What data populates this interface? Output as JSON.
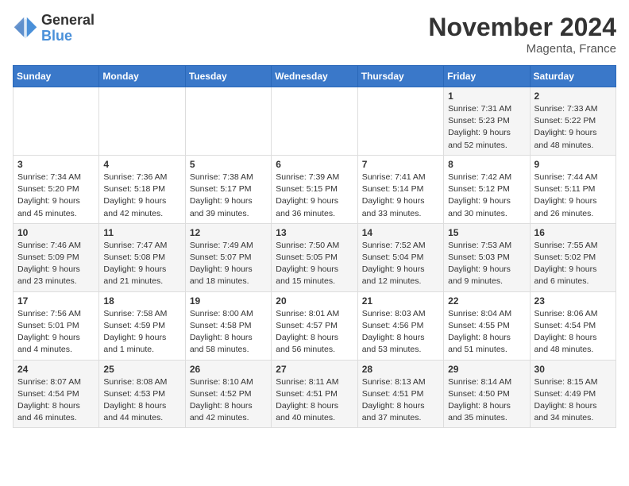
{
  "header": {
    "logo_general": "General",
    "logo_blue": "Blue",
    "month_title": "November 2024",
    "location": "Magenta, France"
  },
  "weekdays": [
    "Sunday",
    "Monday",
    "Tuesday",
    "Wednesday",
    "Thursday",
    "Friday",
    "Saturday"
  ],
  "weeks": [
    [
      {
        "day": "",
        "info": ""
      },
      {
        "day": "",
        "info": ""
      },
      {
        "day": "",
        "info": ""
      },
      {
        "day": "",
        "info": ""
      },
      {
        "day": "",
        "info": ""
      },
      {
        "day": "1",
        "info": "Sunrise: 7:31 AM\nSunset: 5:23 PM\nDaylight: 9 hours and 52 minutes."
      },
      {
        "day": "2",
        "info": "Sunrise: 7:33 AM\nSunset: 5:22 PM\nDaylight: 9 hours and 48 minutes."
      }
    ],
    [
      {
        "day": "3",
        "info": "Sunrise: 7:34 AM\nSunset: 5:20 PM\nDaylight: 9 hours and 45 minutes."
      },
      {
        "day": "4",
        "info": "Sunrise: 7:36 AM\nSunset: 5:18 PM\nDaylight: 9 hours and 42 minutes."
      },
      {
        "day": "5",
        "info": "Sunrise: 7:38 AM\nSunset: 5:17 PM\nDaylight: 9 hours and 39 minutes."
      },
      {
        "day": "6",
        "info": "Sunrise: 7:39 AM\nSunset: 5:15 PM\nDaylight: 9 hours and 36 minutes."
      },
      {
        "day": "7",
        "info": "Sunrise: 7:41 AM\nSunset: 5:14 PM\nDaylight: 9 hours and 33 minutes."
      },
      {
        "day": "8",
        "info": "Sunrise: 7:42 AM\nSunset: 5:12 PM\nDaylight: 9 hours and 30 minutes."
      },
      {
        "day": "9",
        "info": "Sunrise: 7:44 AM\nSunset: 5:11 PM\nDaylight: 9 hours and 26 minutes."
      }
    ],
    [
      {
        "day": "10",
        "info": "Sunrise: 7:46 AM\nSunset: 5:09 PM\nDaylight: 9 hours and 23 minutes."
      },
      {
        "day": "11",
        "info": "Sunrise: 7:47 AM\nSunset: 5:08 PM\nDaylight: 9 hours and 21 minutes."
      },
      {
        "day": "12",
        "info": "Sunrise: 7:49 AM\nSunset: 5:07 PM\nDaylight: 9 hours and 18 minutes."
      },
      {
        "day": "13",
        "info": "Sunrise: 7:50 AM\nSunset: 5:05 PM\nDaylight: 9 hours and 15 minutes."
      },
      {
        "day": "14",
        "info": "Sunrise: 7:52 AM\nSunset: 5:04 PM\nDaylight: 9 hours and 12 minutes."
      },
      {
        "day": "15",
        "info": "Sunrise: 7:53 AM\nSunset: 5:03 PM\nDaylight: 9 hours and 9 minutes."
      },
      {
        "day": "16",
        "info": "Sunrise: 7:55 AM\nSunset: 5:02 PM\nDaylight: 9 hours and 6 minutes."
      }
    ],
    [
      {
        "day": "17",
        "info": "Sunrise: 7:56 AM\nSunset: 5:01 PM\nDaylight: 9 hours and 4 minutes."
      },
      {
        "day": "18",
        "info": "Sunrise: 7:58 AM\nSunset: 4:59 PM\nDaylight: 9 hours and 1 minute."
      },
      {
        "day": "19",
        "info": "Sunrise: 8:00 AM\nSunset: 4:58 PM\nDaylight: 8 hours and 58 minutes."
      },
      {
        "day": "20",
        "info": "Sunrise: 8:01 AM\nSunset: 4:57 PM\nDaylight: 8 hours and 56 minutes."
      },
      {
        "day": "21",
        "info": "Sunrise: 8:03 AM\nSunset: 4:56 PM\nDaylight: 8 hours and 53 minutes."
      },
      {
        "day": "22",
        "info": "Sunrise: 8:04 AM\nSunset: 4:55 PM\nDaylight: 8 hours and 51 minutes."
      },
      {
        "day": "23",
        "info": "Sunrise: 8:06 AM\nSunset: 4:54 PM\nDaylight: 8 hours and 48 minutes."
      }
    ],
    [
      {
        "day": "24",
        "info": "Sunrise: 8:07 AM\nSunset: 4:54 PM\nDaylight: 8 hours and 46 minutes."
      },
      {
        "day": "25",
        "info": "Sunrise: 8:08 AM\nSunset: 4:53 PM\nDaylight: 8 hours and 44 minutes."
      },
      {
        "day": "26",
        "info": "Sunrise: 8:10 AM\nSunset: 4:52 PM\nDaylight: 8 hours and 42 minutes."
      },
      {
        "day": "27",
        "info": "Sunrise: 8:11 AM\nSunset: 4:51 PM\nDaylight: 8 hours and 40 minutes."
      },
      {
        "day": "28",
        "info": "Sunrise: 8:13 AM\nSunset: 4:51 PM\nDaylight: 8 hours and 37 minutes."
      },
      {
        "day": "29",
        "info": "Sunrise: 8:14 AM\nSunset: 4:50 PM\nDaylight: 8 hours and 35 minutes."
      },
      {
        "day": "30",
        "info": "Sunrise: 8:15 AM\nSunset: 4:49 PM\nDaylight: 8 hours and 34 minutes."
      }
    ]
  ]
}
